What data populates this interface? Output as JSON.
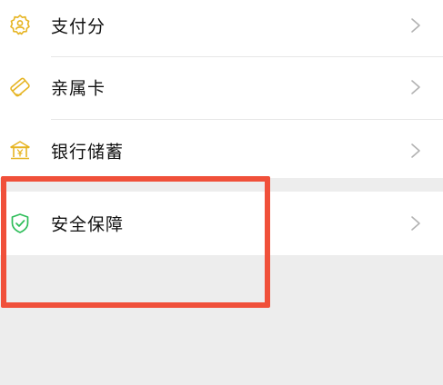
{
  "menu": {
    "items": [
      {
        "label": "支付分",
        "icon": "payscore-icon"
      },
      {
        "label": "亲属卡",
        "icon": "family-card-icon"
      },
      {
        "label": "银行储蓄",
        "icon": "bank-savings-icon"
      },
      {
        "label": "安全保障",
        "icon": "security-shield-icon"
      }
    ]
  },
  "colors": {
    "icon_gold": "#e6b422",
    "icon_green": "#2ebd59",
    "highlight": "#f0503a",
    "background": "#ededed"
  }
}
